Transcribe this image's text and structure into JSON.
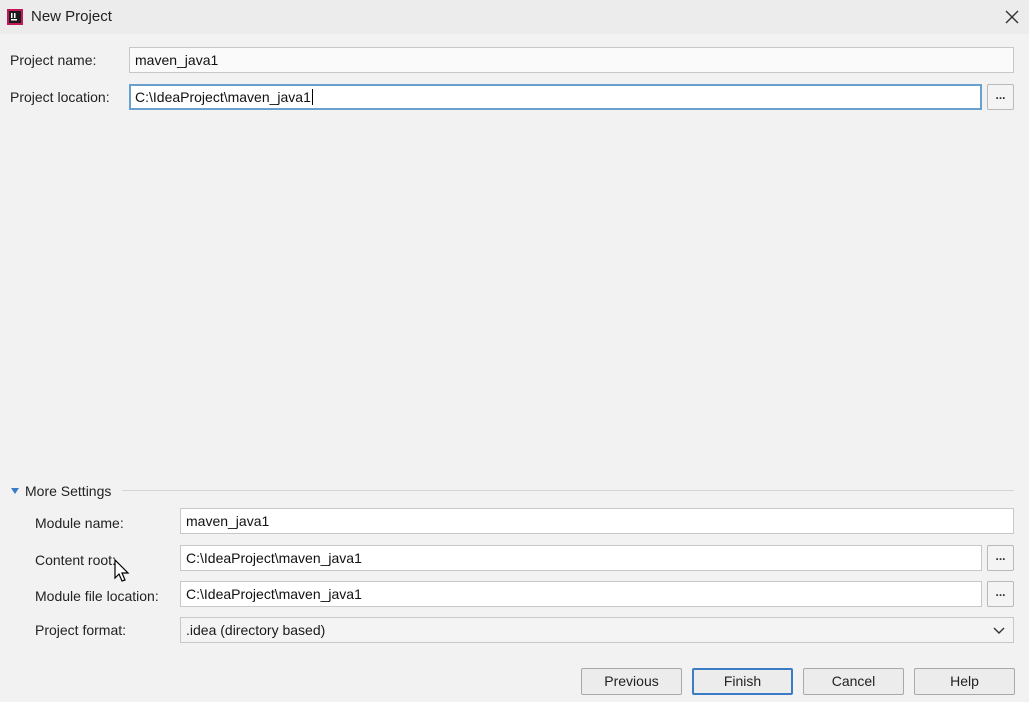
{
  "window": {
    "title": "New Project",
    "close_icon": "close-icon",
    "app_icon": "intellij-app-icon"
  },
  "project": {
    "name_label": "Project name:",
    "name_value": "maven_java1",
    "location_label": "Project location:",
    "location_value": "C:\\IdeaProject\\maven_java1",
    "browse_label": "..."
  },
  "more_settings": {
    "header": "More Settings",
    "expanded": true,
    "module_name_label": "Module name:",
    "module_name_value": "maven_java1",
    "content_root_label": "Content root:",
    "content_root_value": "C:\\IdeaProject\\maven_java1",
    "module_file_location_label": "Module file location:",
    "module_file_location_value": "C:\\IdeaProject\\maven_java1",
    "project_format_label": "Project format:",
    "project_format_value": ".idea (directory based)",
    "browse_label": "..."
  },
  "buttons": {
    "previous": "Previous",
    "finish": "Finish",
    "cancel": "Cancel",
    "help": "Help"
  },
  "colors": {
    "focus_border": "#6aa0cf",
    "accent": "#3a7bc8",
    "primary_button_border": "#3b7cc4"
  }
}
